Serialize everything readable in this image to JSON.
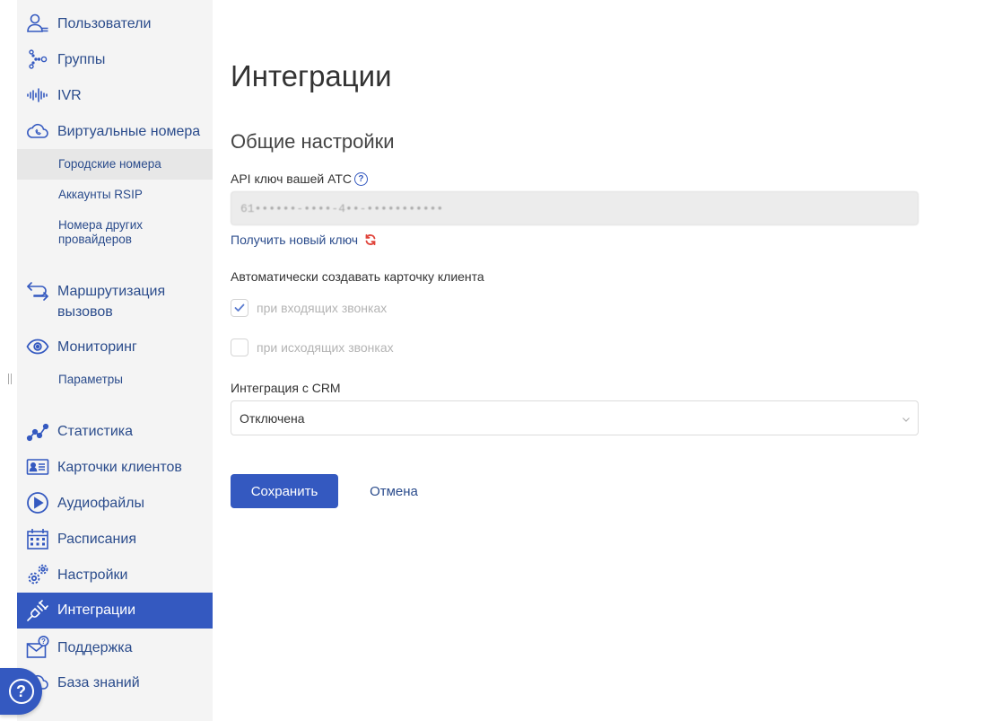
{
  "sidebar": {
    "items": [
      {
        "label": "Пользователи",
        "icon": "users-icon"
      },
      {
        "label": "Группы",
        "icon": "groups-icon"
      },
      {
        "label": "IVR",
        "icon": "ivr-waveform-icon"
      },
      {
        "label": "Виртуальные номера",
        "icon": "cloud-phone-icon"
      },
      {
        "label": "Маршрутизация\nвызовов",
        "icon": "routing-arrows-icon"
      },
      {
        "label": "Мониторинг",
        "icon": "eye-icon"
      },
      {
        "label": "Статистика",
        "icon": "statistics-chart-icon"
      },
      {
        "label": "Карточки клиентов",
        "icon": "client-card-icon"
      },
      {
        "label": "Аудиофайлы",
        "icon": "play-circle-icon"
      },
      {
        "label": "Расписания",
        "icon": "calendar-icon"
      },
      {
        "label": "Настройки",
        "icon": "gears-icon"
      },
      {
        "label": "Интеграции",
        "icon": "plug-icon"
      },
      {
        "label": "Поддержка",
        "icon": "support-mail-icon"
      },
      {
        "label": "База знаний",
        "icon": "knowledge-base-icon"
      }
    ],
    "subitems": {
      "virtual_numbers": [
        "Городские номера",
        "Аккаунты RSIP",
        "Номера других\nпровайдеров"
      ],
      "monitoring": [
        "Параметры"
      ]
    },
    "active_item": "Интеграции",
    "selected_subitem": "Городские номера"
  },
  "main": {
    "page_title": "Интеграции",
    "section_title": "Общие настройки",
    "api_key_label": "API ключ вашей АТС",
    "api_key_help": "?",
    "api_key_value": "61••••••-••••-4••-•••••••••••",
    "get_new_key_link": "Получить новый ключ",
    "auto_card_label": "Автоматически создавать карточку клиента",
    "checkbox_incoming": {
      "label": "при входящих звонках",
      "checked": true
    },
    "checkbox_outgoing": {
      "label": "при исходящих звонках",
      "checked": false
    },
    "crm_label": "Интеграция с CRM",
    "crm_selected": "Отключена",
    "save_button": "Сохранить",
    "cancel_button": "Отмена"
  },
  "help_fab": "?",
  "colors": {
    "accent": "#3459c0",
    "link": "#2b4c8c",
    "sidebar_bg": "#f4f4f4",
    "refresh_icon": "#e0433a"
  }
}
